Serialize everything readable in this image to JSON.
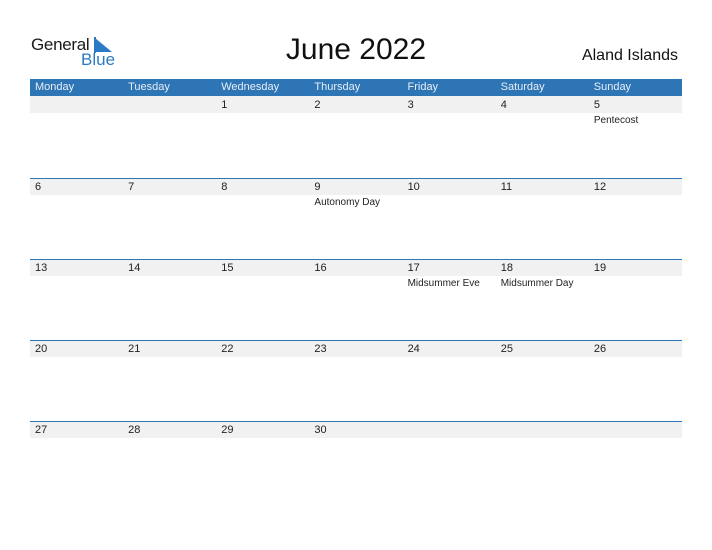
{
  "logo": {
    "word1": "General",
    "word2": "Blue"
  },
  "title": "June 2022",
  "country": "Aland Islands",
  "colors": {
    "accent": "#2e75b6",
    "date_strip": "#f1f1f1"
  },
  "weekdays": [
    "Monday",
    "Tuesday",
    "Wednesday",
    "Thursday",
    "Friday",
    "Saturday",
    "Sunday"
  ],
  "weeks": [
    [
      {
        "day": ""
      },
      {
        "day": ""
      },
      {
        "day": "1"
      },
      {
        "day": "2"
      },
      {
        "day": "3"
      },
      {
        "day": "4"
      },
      {
        "day": "5",
        "holiday": "Pentecost"
      }
    ],
    [
      {
        "day": "6"
      },
      {
        "day": "7"
      },
      {
        "day": "8"
      },
      {
        "day": "9",
        "holiday": "Autonomy Day"
      },
      {
        "day": "10"
      },
      {
        "day": "11"
      },
      {
        "day": "12"
      }
    ],
    [
      {
        "day": "13"
      },
      {
        "day": "14"
      },
      {
        "day": "15"
      },
      {
        "day": "16"
      },
      {
        "day": "17",
        "holiday": "Midsummer Eve"
      },
      {
        "day": "18",
        "holiday": "Midsummer Day"
      },
      {
        "day": "19"
      }
    ],
    [
      {
        "day": "20"
      },
      {
        "day": "21"
      },
      {
        "day": "22"
      },
      {
        "day": "23"
      },
      {
        "day": "24"
      },
      {
        "day": "25"
      },
      {
        "day": "26"
      }
    ],
    [
      {
        "day": "27"
      },
      {
        "day": "28"
      },
      {
        "day": "29"
      },
      {
        "day": "30"
      },
      {
        "day": ""
      },
      {
        "day": ""
      },
      {
        "day": ""
      }
    ]
  ]
}
